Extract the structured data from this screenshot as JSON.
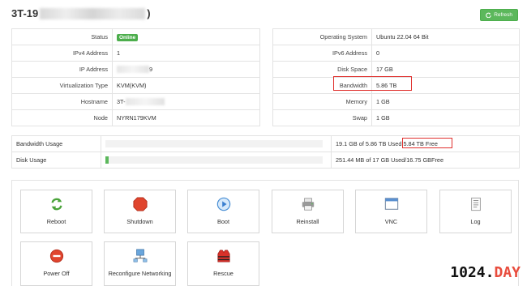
{
  "header": {
    "title_prefix": "3T-19",
    "title_suffix": ")",
    "refresh_label": "Refresh"
  },
  "left_table": [
    {
      "label": "Status",
      "value": "Online"
    },
    {
      "label": "IPv4 Address",
      "value": "1"
    },
    {
      "label": "IP Address",
      "value": "9"
    },
    {
      "label": "Virtualization Type",
      "value": "KVM(KVM)"
    },
    {
      "label": "Hostname",
      "value": "3T-"
    },
    {
      "label": "Node",
      "value": "NYRN179KVM"
    }
  ],
  "right_table": [
    {
      "label": "Operating System",
      "value": "Ubuntu 22.04 64 Bit"
    },
    {
      "label": "IPv6 Address",
      "value": "0"
    },
    {
      "label": "Disk Space",
      "value": "17 GB"
    },
    {
      "label": "Bandwidth",
      "value": "5.86 TB"
    },
    {
      "label": "Memory",
      "value": "1 GB"
    },
    {
      "label": "Swap",
      "value": "1 GB"
    }
  ],
  "usage": {
    "bandwidth": {
      "label": "Bandwidth Usage",
      "used_text": "19.1 GB of 5.86 TB Used",
      "free_text": "5.84 TB Free",
      "fraction": 0.0
    },
    "disk": {
      "label": "Disk Usage",
      "text": "251.44 MB of 17 GB Used/16.75 GBFree",
      "fraction": 0.015
    }
  },
  "actions": [
    {
      "label": "Reboot",
      "icon": "refresh-icon"
    },
    {
      "label": "Shutdown",
      "icon": "stop-icon"
    },
    {
      "label": "Boot",
      "icon": "play-icon"
    },
    {
      "label": "Reinstall",
      "icon": "printer-icon"
    },
    {
      "label": "VNC",
      "icon": "window-icon"
    },
    {
      "label": "Log",
      "icon": "document-icon"
    },
    {
      "label": "Power Off",
      "icon": "power-off-icon"
    },
    {
      "label": "Reconfigure Networking",
      "icon": "network-icon"
    },
    {
      "label": "Rescue",
      "icon": "life-jacket-icon"
    }
  ],
  "watermark": {
    "main": "1024.",
    "accent": "DAY"
  },
  "colors": {
    "online": "#4cae4c",
    "refresh": "#5cb85c",
    "highlight": "#e0302d"
  }
}
